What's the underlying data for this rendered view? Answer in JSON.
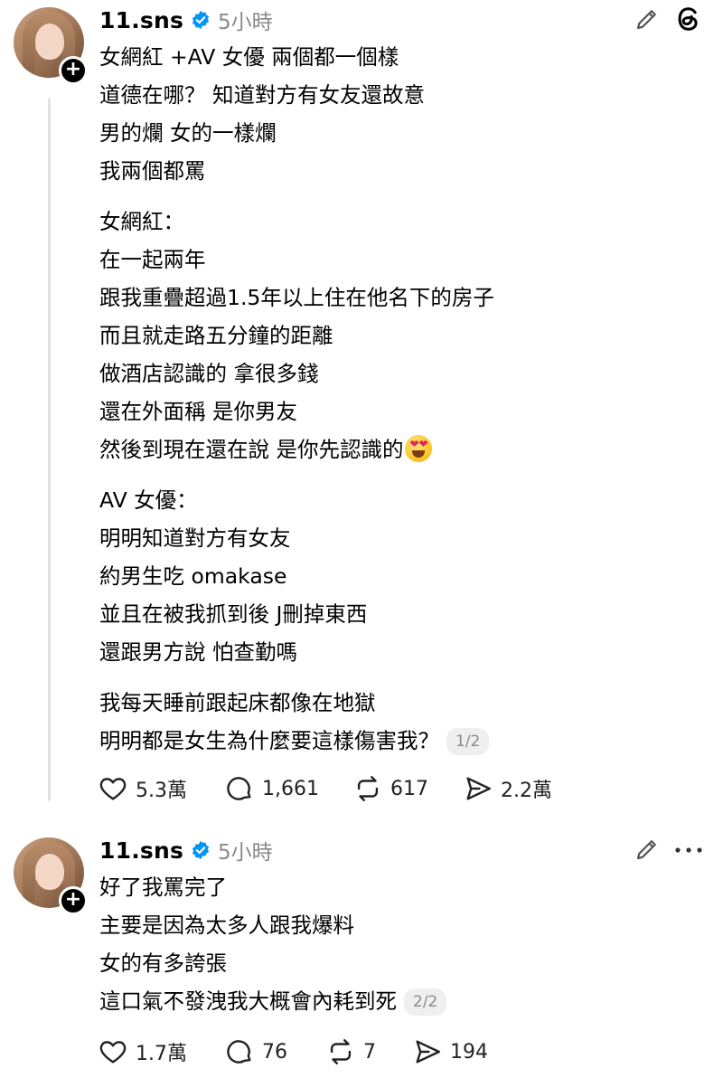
{
  "posts": [
    {
      "username": "11.sns",
      "time": "5小時",
      "lines": [
        "女網紅 +AV 女優 兩個都一個樣",
        "道德在哪？ 知道對方有女友還故意",
        "男的爛 女的一樣爛",
        "我兩個都罵",
        "女網紅：",
        "在一起兩年",
        "跟我重疊超過1.5年以上住在他名下的房子",
        "而且就走路五分鐘的距離",
        "做酒店認識的 拿很多錢",
        "還在外面稱 是你男友",
        "然後到現在還在說 是你先認識的",
        "AV 女優：",
        "明明知道對方有女友",
        "約男生吃 omakase",
        "並且在被我抓到後 J刪掉東西",
        "還跟男方說 怕查勤嗎",
        "我每天睡前跟起床都像在地獄",
        "明明都是女生為什麼要這樣傷害我？"
      ],
      "page_indicator": "1/2",
      "likes": "5.3萬",
      "comments": "1,661",
      "reposts": "617",
      "shares": "2.2萬"
    },
    {
      "username": "11.sns",
      "time": "5小時",
      "lines": [
        "好了我罵完了",
        "主要是因為太多人跟我爆料",
        "女的有多誇張",
        "這口氣不發洩我大概會內耗到死"
      ],
      "page_indicator": "2/2",
      "likes": "1.7萬",
      "comments": "76",
      "reposts": "7",
      "shares": "194"
    }
  ],
  "icons": {
    "verified": "verified-badge-icon",
    "edit": "pencil-icon",
    "app": "threads-logo-icon",
    "more": "more-icon",
    "like": "heart-icon",
    "comment": "comment-icon",
    "repost": "repost-icon",
    "share": "send-icon",
    "emoji": "heart-eyes-emoji"
  },
  "colors": {
    "verified": "#0095f6",
    "muted": "#8a8a8a"
  }
}
